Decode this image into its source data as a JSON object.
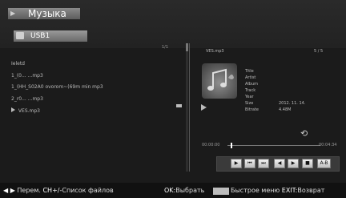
{
  "header": {
    "title": "Музыка",
    "path": "USB1"
  },
  "file_list": {
    "pager": "1/1",
    "items": [
      {
        "label": "Ieletd"
      },
      {
        "label": "1_(0... ...mp3"
      },
      {
        "label": "1_(HH_S02A0 ovorom~(69m min mp3"
      },
      {
        "label": "2_r0... ...mp3"
      },
      {
        "label": "VES.mp3"
      }
    ]
  },
  "info": {
    "file_name": "VES.mp3",
    "position": "5 / 5",
    "meta": [
      {
        "k": "Title",
        "v": ""
      },
      {
        "k": "Artist",
        "v": ""
      },
      {
        "k": "Album",
        "v": ""
      },
      {
        "k": "Track",
        "v": ""
      },
      {
        "k": "Year",
        "v": ""
      },
      {
        "k": "Size",
        "v": "2012. 11. 14."
      },
      {
        "k": "Bitrate",
        "v": "4.48M"
      }
    ],
    "time_current": "00:00:00",
    "time_total": "00:04:34"
  },
  "controls": {
    "play": "▶",
    "prev": "⏮",
    "next": "⏭",
    "rew": "◀",
    "ff": "▶",
    "stop": "■",
    "ab": "A-B"
  },
  "help": {
    "move_key": "◀ ▶",
    "move": "Перем.",
    "ch_key": "CH+/-",
    "list": "Список файлов",
    "ok_key": "OK:",
    "select": "Выбрать",
    "menu": "Быстрое меню",
    "exit_key": "EXIT:",
    "exit": "Возврат"
  }
}
